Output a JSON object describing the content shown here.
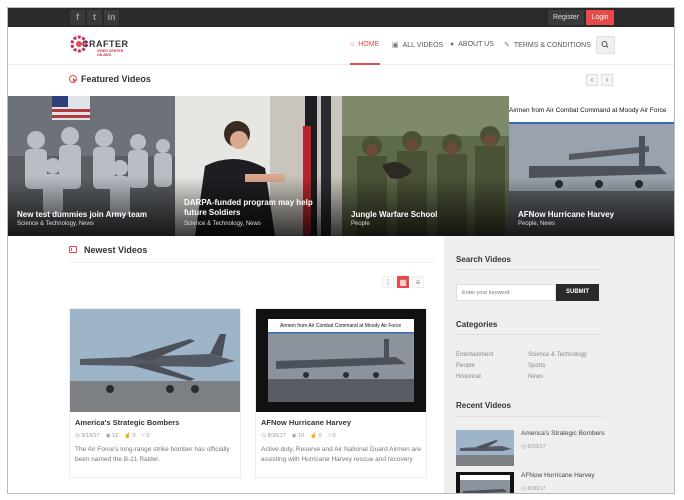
{
  "topbar": {
    "social": [
      "f",
      "t",
      "in"
    ],
    "register": "Register",
    "login": "Login"
  },
  "logo": {
    "name": "CRAFTER",
    "sub": "VIDEO CENTER ON AWS"
  },
  "nav": [
    {
      "label": "HOME",
      "icon": "home-icon"
    },
    {
      "label": "ALL VIDEOS",
      "icon": "film-icon"
    },
    {
      "label": "ABOUT US",
      "icon": "user-icon"
    },
    {
      "label": "TERMS & CONDITIONS",
      "icon": "edit-icon"
    }
  ],
  "featured": {
    "title": "Featured Videos",
    "items": [
      {
        "title": "New test dummies join Army team",
        "category": "Science & Technology, News"
      },
      {
        "title": "DARPA-funded program may help future Soldiers",
        "category": "Science & Technology, News"
      },
      {
        "title": "Jungle Warfare School",
        "category": "People"
      },
      {
        "title": "AFNow Hurricane Harvey",
        "category": "People, News",
        "overlay": "Airmen from Air Combat Command at Moody Air Force"
      }
    ]
  },
  "newest": {
    "title": "Newest Videos",
    "videos": [
      {
        "title": "America's Strategic Bombers",
        "date": "9/19/17",
        "views": "12",
        "likes": "0",
        "dislikes": "0",
        "desc": "The Air Force's long-range strike bomber has officially been named the B-21 Raider."
      },
      {
        "title": "AFNow Hurricane Harvey",
        "date": "8/30/17",
        "views": "10",
        "likes": "0",
        "dislikes": "0",
        "desc": "Active duty, Reserve and Air National Guard Airmen are assisting with Hurricane Harvey rescue and recovery",
        "overlay": "Airmen from Air Combat Command at Moody Air Force"
      }
    ]
  },
  "sidebar": {
    "search_title": "Search Videos",
    "search_placeholder": "Enter your keyword",
    "submit": "SUBMIT",
    "categories_title": "Categories",
    "categories": [
      "Entertainment",
      "Science & Technology",
      "People",
      "Sports",
      "Historical",
      "News"
    ],
    "recent_title": "Recent Videos",
    "recent": [
      {
        "title": "America's Strategic Bombers",
        "date": "9/19/17"
      },
      {
        "title": "AFNow Hurricane Harvey",
        "date": "8/30/17"
      }
    ]
  },
  "colors": {
    "accent": "#e54b4b",
    "topbar": "#2a2a2a",
    "sidebar": "#efefef"
  }
}
